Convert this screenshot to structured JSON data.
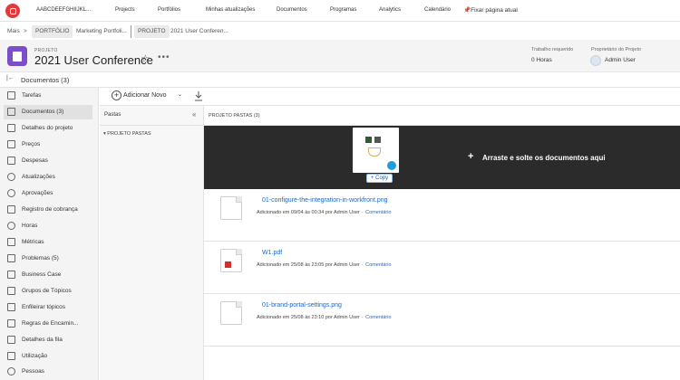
{
  "topnav": {
    "org_name": "AABCDEEFGHIIJKL...",
    "links": [
      "Projects",
      "Portfólios",
      "Minhas atualizações",
      "Documentos",
      "Programas",
      "Analytics",
      "Calendário"
    ],
    "pin_label": "Fixar página atual"
  },
  "breadcrumb": {
    "more": "Mais",
    "sep": ">",
    "portfolio_chip": "PORTFÓLIO",
    "portfolio_name": "Marketing Portfoli...",
    "project_chip": "PROJETO",
    "project_name": "2021 User Conferen..."
  },
  "header": {
    "label": "PROJETO",
    "title": "2021 User Conference",
    "more_dots": "•••",
    "work_label": "Trabalho requerido",
    "work_value": "0 Horas",
    "owner_label": "Proprietário do Projeto",
    "owner_name": "Admin User"
  },
  "section": {
    "title": "Documentos (3)"
  },
  "sidebar": {
    "items": [
      {
        "label": "Tarefas",
        "icon": "tasks-icon"
      },
      {
        "label": "Documentos (3)",
        "icon": "documents-icon",
        "active": true
      },
      {
        "label": "Detalhes do projeto",
        "icon": "details-icon"
      },
      {
        "label": "Preços",
        "icon": "pricing-icon"
      },
      {
        "label": "Despesas",
        "icon": "expenses-icon"
      },
      {
        "label": "Atualizações",
        "icon": "updates-icon"
      },
      {
        "label": "Aprovações",
        "icon": "approvals-icon"
      },
      {
        "label": "Registro de cobrança",
        "icon": "billing-icon"
      },
      {
        "label": "Horas",
        "icon": "hours-icon"
      },
      {
        "label": "Métricas",
        "icon": "metrics-icon"
      },
      {
        "label": "Problemas (5)",
        "icon": "issues-icon"
      },
      {
        "label": "Business Case",
        "icon": "business-case-icon"
      },
      {
        "label": "Grupos de Tópicos",
        "icon": "topic-groups-icon"
      },
      {
        "label": "Enfileirar tópicos",
        "icon": "queue-topics-icon"
      },
      {
        "label": "Regras de Encamin...",
        "icon": "routing-rules-icon"
      },
      {
        "label": "Detalhes da fila",
        "icon": "queue-details-icon"
      },
      {
        "label": "Utilização",
        "icon": "utilization-icon"
      },
      {
        "label": "Pessoas",
        "icon": "people-icon"
      }
    ]
  },
  "toolbar": {
    "add_label": "Adicionar Novo"
  },
  "folders": {
    "title": "Pastas",
    "project_folders": "PROJETO PASTAS"
  },
  "main": {
    "header": "PROJETO PASTAS (3)",
    "drop_message": "Arraste e solte os documentos aqui",
    "copy_label": "+ Copy",
    "documents": [
      {
        "name": "01-configure-the-integration-in-workfront.png",
        "meta": "Adicionado em 09/04 às 00:34 por Admin User ·",
        "comment": "Comentário",
        "type": "png"
      },
      {
        "name": "W1.pdf",
        "meta": "Adicionado em 25/08 às 23:05 por Admin User ·",
        "comment": "Comentário",
        "type": "pdf"
      },
      {
        "name": "01-brand-portal-settings.png",
        "meta": "Adicionado em 25/08 às 23:10 por Admin User ·",
        "comment": "Comentário",
        "type": "png"
      }
    ]
  },
  "colors": {
    "accent": "#1a68c7",
    "project_icon": "#7b4fc9",
    "logo": "#e03a3a",
    "dropzone": "#2b2b2b"
  }
}
